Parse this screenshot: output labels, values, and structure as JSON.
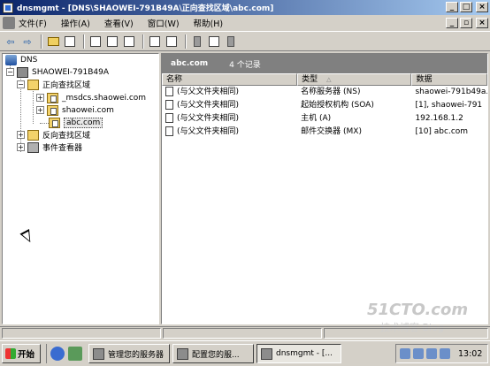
{
  "window": {
    "title": "dnsmgmt - [DNS\\SHAOWEI-791B49A\\正向查找区域\\abc.com]"
  },
  "menu": [
    "文件(F)",
    "操作(A)",
    "查看(V)",
    "窗口(W)",
    "帮助(H)"
  ],
  "tree": {
    "root": "DNS",
    "server": "SHAOWEI-791B49A",
    "forward_zone": "正向查找区域",
    "zones": [
      "_msdcs.shaowei.com",
      "shaowei.com",
      "abc.com"
    ],
    "reverse_zone": "反向查找区域",
    "event_viewer": "事件查看器"
  },
  "details": {
    "zone_name": "abc.com",
    "record_count": "4 个记录",
    "columns": [
      "名称",
      "类型",
      "数据"
    ],
    "rows": [
      [
        "(与父文件夹相同)",
        "名称服务器 (NS)",
        "shaowei-791b49a."
      ],
      [
        "(与父文件夹相同)",
        "起始授权机构 (SOA)",
        "[1], shaowei-791"
      ],
      [
        "(与父文件夹相同)",
        "主机 (A)",
        "192.168.1.2"
      ],
      [
        "(与父文件夹相同)",
        "邮件交换器 (MX)",
        "[10]  abc.com"
      ]
    ]
  },
  "watermark": {
    "line1": "51CTO.com",
    "line2": "技术博客  Blog"
  },
  "taskbar": {
    "start": "开始",
    "buttons": [
      "管理您的服务器",
      "配置您的服...",
      "dnsmgmt - [..."
    ],
    "clock": "13:02"
  }
}
